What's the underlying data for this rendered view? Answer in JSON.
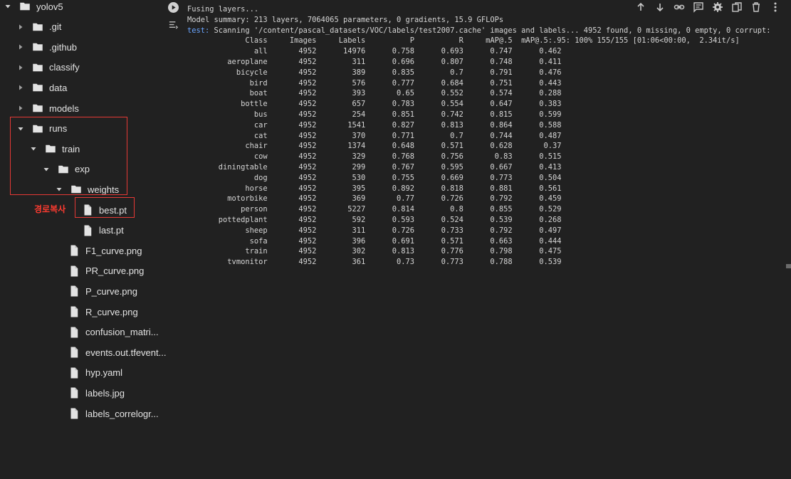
{
  "file_tree": [
    {
      "label": "yolov5",
      "type": "folder",
      "expanded": true,
      "depth": 0
    },
    {
      "label": ".git",
      "type": "folder",
      "expanded": false,
      "depth": 1
    },
    {
      "label": ".github",
      "type": "folder",
      "expanded": false,
      "depth": 1
    },
    {
      "label": "classify",
      "type": "folder",
      "expanded": false,
      "depth": 1
    },
    {
      "label": "data",
      "type": "folder",
      "expanded": false,
      "depth": 1
    },
    {
      "label": "models",
      "type": "folder",
      "expanded": false,
      "depth": 1
    },
    {
      "label": "runs",
      "type": "folder",
      "expanded": true,
      "depth": 1
    },
    {
      "label": "train",
      "type": "folder",
      "expanded": true,
      "depth": 2
    },
    {
      "label": "exp",
      "type": "folder",
      "expanded": true,
      "depth": 3
    },
    {
      "label": "weights",
      "type": "folder",
      "expanded": true,
      "depth": 4
    },
    {
      "label": "best.pt",
      "type": "file",
      "depth": 5
    },
    {
      "label": "last.pt",
      "type": "file",
      "depth": 5
    },
    {
      "label": "F1_curve.png",
      "type": "file",
      "depth": 4
    },
    {
      "label": "PR_curve.png",
      "type": "file",
      "depth": 4
    },
    {
      "label": "P_curve.png",
      "type": "file",
      "depth": 4
    },
    {
      "label": "R_curve.png",
      "type": "file",
      "depth": 4
    },
    {
      "label": "confusion_matri...",
      "type": "file",
      "depth": 4
    },
    {
      "label": "events.out.tfevent...",
      "type": "file",
      "depth": 4
    },
    {
      "label": "hyp.yaml",
      "type": "file",
      "depth": 4
    },
    {
      "label": "labels.jpg",
      "type": "file",
      "depth": 4
    },
    {
      "label": "labels_correlogr...",
      "type": "file",
      "depth": 4
    }
  ],
  "annotation": "경로복사",
  "toolbar_icons": [
    "arrow-up-icon",
    "arrow-down-icon",
    "link-icon",
    "comment-icon",
    "settings-icon",
    "mirror-cell-icon",
    "delete-icon",
    "more-icon"
  ],
  "output": {
    "line1": "Fusing layers...",
    "line2": "Model summary: 213 layers, 7064065 parameters, 0 gradients, 15.9 GFLOPs",
    "scan_prefix": "test:",
    "scan_text": " Scanning '/content/pascal_datasets/VOC/labels/test2007.cache' images and labels... 4952 found, 0 missing, 0 empty, 0 corrupt:",
    "header": [
      "Class",
      "Images",
      "Labels",
      "P",
      "R",
      "mAP@.5",
      "mAP@.5:.95: 100% 155/155 [01:06<00:00,  2.34it/s]"
    ],
    "rows": [
      [
        "all",
        "4952",
        "14976",
        "0.758",
        "0.693",
        "0.747",
        "0.462"
      ],
      [
        "aeroplane",
        "4952",
        "311",
        "0.696",
        "0.807",
        "0.748",
        "0.411"
      ],
      [
        "bicycle",
        "4952",
        "389",
        "0.835",
        "0.7",
        "0.791",
        "0.476"
      ],
      [
        "bird",
        "4952",
        "576",
        "0.777",
        "0.684",
        "0.751",
        "0.443"
      ],
      [
        "boat",
        "4952",
        "393",
        "0.65",
        "0.552",
        "0.574",
        "0.288"
      ],
      [
        "bottle",
        "4952",
        "657",
        "0.783",
        "0.554",
        "0.647",
        "0.383"
      ],
      [
        "bus",
        "4952",
        "254",
        "0.851",
        "0.742",
        "0.815",
        "0.599"
      ],
      [
        "car",
        "4952",
        "1541",
        "0.827",
        "0.813",
        "0.864",
        "0.588"
      ],
      [
        "cat",
        "4952",
        "370",
        "0.771",
        "0.7",
        "0.744",
        "0.487"
      ],
      [
        "chair",
        "4952",
        "1374",
        "0.648",
        "0.571",
        "0.628",
        "0.37"
      ],
      [
        "cow",
        "4952",
        "329",
        "0.768",
        "0.756",
        "0.83",
        "0.515"
      ],
      [
        "diningtable",
        "4952",
        "299",
        "0.767",
        "0.595",
        "0.667",
        "0.413"
      ],
      [
        "dog",
        "4952",
        "530",
        "0.755",
        "0.669",
        "0.773",
        "0.504"
      ],
      [
        "horse",
        "4952",
        "395",
        "0.892",
        "0.818",
        "0.881",
        "0.561"
      ],
      [
        "motorbike",
        "4952",
        "369",
        "0.77",
        "0.726",
        "0.792",
        "0.459"
      ],
      [
        "person",
        "4952",
        "5227",
        "0.814",
        "0.8",
        "0.855",
        "0.529"
      ],
      [
        "pottedplant",
        "4952",
        "592",
        "0.593",
        "0.524",
        "0.539",
        "0.268"
      ],
      [
        "sheep",
        "4952",
        "311",
        "0.726",
        "0.733",
        "0.792",
        "0.497"
      ],
      [
        "sofa",
        "4952",
        "396",
        "0.691",
        "0.571",
        "0.663",
        "0.444"
      ],
      [
        "train",
        "4952",
        "302",
        "0.813",
        "0.776",
        "0.798",
        "0.475"
      ],
      [
        "tvmonitor",
        "4952",
        "361",
        "0.73",
        "0.773",
        "0.788",
        "0.539"
      ]
    ]
  },
  "colors": {
    "background": "#212121",
    "annotation_red": "#e53935",
    "keyword_blue": "#6aa5ff",
    "text": "#e3e3e3"
  }
}
